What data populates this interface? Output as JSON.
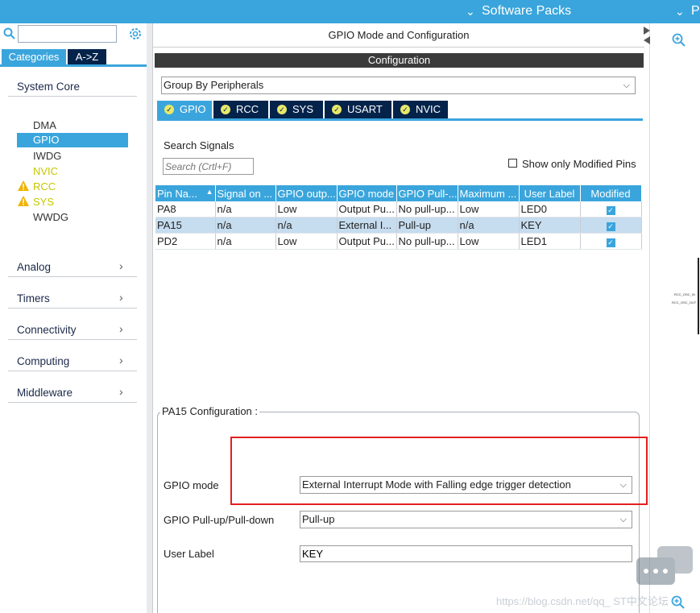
{
  "topbar": {
    "software_packs": "Software Packs",
    "right_cut": "P"
  },
  "left": {
    "tabs": {
      "categories": "Categories",
      "az": "A->Z"
    },
    "system_core": {
      "label": "System Core",
      "items": [
        {
          "label": "DMA",
          "state": "normal"
        },
        {
          "label": "GPIO",
          "state": "selected"
        },
        {
          "label": "IWDG",
          "state": "normal"
        },
        {
          "label": "NVIC",
          "state": "configured"
        },
        {
          "label": "RCC",
          "state": "warning"
        },
        {
          "label": "SYS",
          "state": "warning"
        },
        {
          "label": "WWDG",
          "state": "normal"
        }
      ]
    },
    "categories": [
      {
        "label": "Analog"
      },
      {
        "label": "Timers"
      },
      {
        "label": "Connectivity"
      },
      {
        "label": "Computing"
      },
      {
        "label": "Middleware"
      }
    ]
  },
  "main": {
    "title": "GPIO Mode and Configuration",
    "config_bar": "Configuration",
    "group_by": "Group By Peripherals",
    "tabs": [
      "GPIO",
      "RCC",
      "SYS",
      "USART",
      "NVIC"
    ],
    "active_tab": "GPIO",
    "search_label": "Search Signals",
    "search_placeholder": "Search (Crtl+F)",
    "show_modified": "Show only Modified Pins",
    "table": {
      "headers": [
        "Pin Na...",
        "Signal on ...",
        "GPIO outp...",
        "GPIO mode",
        "GPIO Pull-...",
        "Maximum ...",
        "User Label",
        "Modified"
      ],
      "rows": [
        [
          "PA8",
          "n/a",
          "Low",
          "Output Pu...",
          "No pull-up...",
          "Low",
          "LED0",
          true
        ],
        [
          "PA15",
          "n/a",
          "n/a",
          "External I...",
          "Pull-up",
          "n/a",
          "KEY",
          true
        ],
        [
          "PD2",
          "n/a",
          "Low",
          "Output Pu...",
          "No pull-up...",
          "Low",
          "LED1",
          true
        ]
      ],
      "selected_row": 1
    },
    "pin_config": {
      "title": "PA15 Configuration :",
      "gpio_mode_label": "GPIO mode",
      "gpio_mode_value": "External Interrupt Mode with Falling edge trigger detection",
      "pull_label": "GPIO Pull-up/Pull-down",
      "pull_value": "Pull-up",
      "user_label_label": "User Label",
      "user_label_value": "KEY"
    }
  },
  "right_panel": {
    "pin_a": "RCC_OSC_IN",
    "pin_b": "RCC_OSC_OUT"
  },
  "watermark": "https://blog.csdn.net/qq_  ST中文论坛",
  "colors": {
    "accent": "#3aa5dc",
    "dark_navy": "#03234b",
    "highlight": "#e41f1f",
    "selected_row": "#c6dcef",
    "warning": "#f0b400",
    "configured": "#c7c700"
  }
}
